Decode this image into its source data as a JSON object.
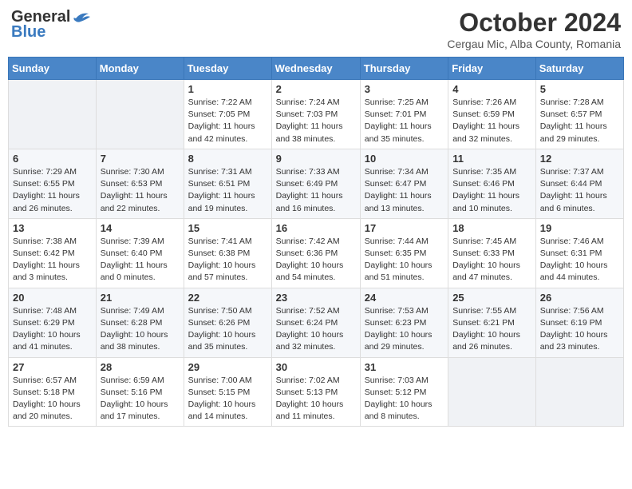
{
  "header": {
    "logo_general": "General",
    "logo_blue": "Blue",
    "month_title": "October 2024",
    "location": "Cergau Mic, Alba County, Romania"
  },
  "days_of_week": [
    "Sunday",
    "Monday",
    "Tuesday",
    "Wednesday",
    "Thursday",
    "Friday",
    "Saturday"
  ],
  "weeks": [
    [
      {
        "day": "",
        "info": ""
      },
      {
        "day": "",
        "info": ""
      },
      {
        "day": "1",
        "info": "Sunrise: 7:22 AM\nSunset: 7:05 PM\nDaylight: 11 hours and 42 minutes."
      },
      {
        "day": "2",
        "info": "Sunrise: 7:24 AM\nSunset: 7:03 PM\nDaylight: 11 hours and 38 minutes."
      },
      {
        "day": "3",
        "info": "Sunrise: 7:25 AM\nSunset: 7:01 PM\nDaylight: 11 hours and 35 minutes."
      },
      {
        "day": "4",
        "info": "Sunrise: 7:26 AM\nSunset: 6:59 PM\nDaylight: 11 hours and 32 minutes."
      },
      {
        "day": "5",
        "info": "Sunrise: 7:28 AM\nSunset: 6:57 PM\nDaylight: 11 hours and 29 minutes."
      }
    ],
    [
      {
        "day": "6",
        "info": "Sunrise: 7:29 AM\nSunset: 6:55 PM\nDaylight: 11 hours and 26 minutes."
      },
      {
        "day": "7",
        "info": "Sunrise: 7:30 AM\nSunset: 6:53 PM\nDaylight: 11 hours and 22 minutes."
      },
      {
        "day": "8",
        "info": "Sunrise: 7:31 AM\nSunset: 6:51 PM\nDaylight: 11 hours and 19 minutes."
      },
      {
        "day": "9",
        "info": "Sunrise: 7:33 AM\nSunset: 6:49 PM\nDaylight: 11 hours and 16 minutes."
      },
      {
        "day": "10",
        "info": "Sunrise: 7:34 AM\nSunset: 6:47 PM\nDaylight: 11 hours and 13 minutes."
      },
      {
        "day": "11",
        "info": "Sunrise: 7:35 AM\nSunset: 6:46 PM\nDaylight: 11 hours and 10 minutes."
      },
      {
        "day": "12",
        "info": "Sunrise: 7:37 AM\nSunset: 6:44 PM\nDaylight: 11 hours and 6 minutes."
      }
    ],
    [
      {
        "day": "13",
        "info": "Sunrise: 7:38 AM\nSunset: 6:42 PM\nDaylight: 11 hours and 3 minutes."
      },
      {
        "day": "14",
        "info": "Sunrise: 7:39 AM\nSunset: 6:40 PM\nDaylight: 11 hours and 0 minutes."
      },
      {
        "day": "15",
        "info": "Sunrise: 7:41 AM\nSunset: 6:38 PM\nDaylight: 10 hours and 57 minutes."
      },
      {
        "day": "16",
        "info": "Sunrise: 7:42 AM\nSunset: 6:36 PM\nDaylight: 10 hours and 54 minutes."
      },
      {
        "day": "17",
        "info": "Sunrise: 7:44 AM\nSunset: 6:35 PM\nDaylight: 10 hours and 51 minutes."
      },
      {
        "day": "18",
        "info": "Sunrise: 7:45 AM\nSunset: 6:33 PM\nDaylight: 10 hours and 47 minutes."
      },
      {
        "day": "19",
        "info": "Sunrise: 7:46 AM\nSunset: 6:31 PM\nDaylight: 10 hours and 44 minutes."
      }
    ],
    [
      {
        "day": "20",
        "info": "Sunrise: 7:48 AM\nSunset: 6:29 PM\nDaylight: 10 hours and 41 minutes."
      },
      {
        "day": "21",
        "info": "Sunrise: 7:49 AM\nSunset: 6:28 PM\nDaylight: 10 hours and 38 minutes."
      },
      {
        "day": "22",
        "info": "Sunrise: 7:50 AM\nSunset: 6:26 PM\nDaylight: 10 hours and 35 minutes."
      },
      {
        "day": "23",
        "info": "Sunrise: 7:52 AM\nSunset: 6:24 PM\nDaylight: 10 hours and 32 minutes."
      },
      {
        "day": "24",
        "info": "Sunrise: 7:53 AM\nSunset: 6:23 PM\nDaylight: 10 hours and 29 minutes."
      },
      {
        "day": "25",
        "info": "Sunrise: 7:55 AM\nSunset: 6:21 PM\nDaylight: 10 hours and 26 minutes."
      },
      {
        "day": "26",
        "info": "Sunrise: 7:56 AM\nSunset: 6:19 PM\nDaylight: 10 hours and 23 minutes."
      }
    ],
    [
      {
        "day": "27",
        "info": "Sunrise: 6:57 AM\nSunset: 5:18 PM\nDaylight: 10 hours and 20 minutes."
      },
      {
        "day": "28",
        "info": "Sunrise: 6:59 AM\nSunset: 5:16 PM\nDaylight: 10 hours and 17 minutes."
      },
      {
        "day": "29",
        "info": "Sunrise: 7:00 AM\nSunset: 5:15 PM\nDaylight: 10 hours and 14 minutes."
      },
      {
        "day": "30",
        "info": "Sunrise: 7:02 AM\nSunset: 5:13 PM\nDaylight: 10 hours and 11 minutes."
      },
      {
        "day": "31",
        "info": "Sunrise: 7:03 AM\nSunset: 5:12 PM\nDaylight: 10 hours and 8 minutes."
      },
      {
        "day": "",
        "info": ""
      },
      {
        "day": "",
        "info": ""
      }
    ]
  ]
}
